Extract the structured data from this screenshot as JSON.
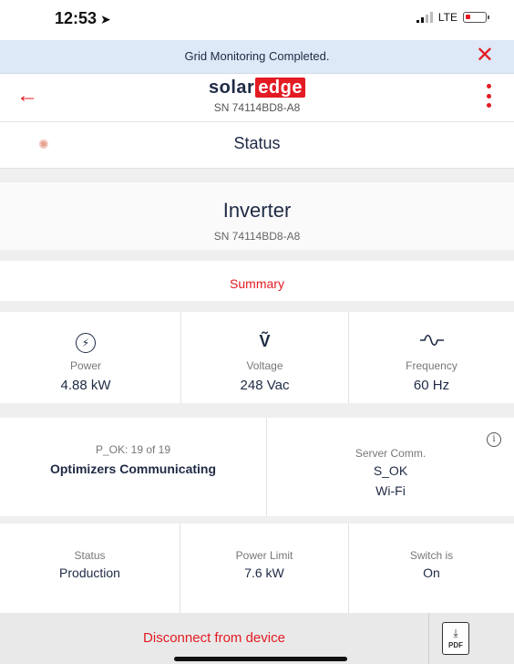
{
  "status_bar": {
    "time": "12:53",
    "network": "LTE"
  },
  "notice": {
    "text": "Grid Monitoring Completed.",
    "close_icon": "close-icon"
  },
  "header": {
    "logo_left": "solar",
    "logo_right": "edge",
    "serial": "SN 74114BD8-A8"
  },
  "status_section": {
    "title": "Status"
  },
  "inverter": {
    "title": "Inverter",
    "serial": "SN 74114BD8-A8"
  },
  "summary_link": "Summary",
  "metrics": [
    {
      "label": "Power",
      "value": "4.88 kW",
      "icon": "lightning-bolt-icon"
    },
    {
      "label": "Voltage",
      "value": "248 Vac",
      "icon": "voltage-icon"
    },
    {
      "label": "Frequency",
      "value": "60 Hz",
      "icon": "sine-wave-icon"
    }
  ],
  "comm": {
    "optimizers_label": "P_OK: 19 of 19",
    "optimizers_value": "Optimizers Communicating",
    "server_label": "Server Comm.",
    "server_value": "S_OK",
    "server_medium": "Wi-Fi"
  },
  "state": [
    {
      "label": "Status",
      "value": "Production"
    },
    {
      "label": "Power Limit",
      "value": "7.6 kW"
    },
    {
      "label": "Switch is",
      "value": "On"
    }
  ],
  "footer": {
    "disconnect": "Disconnect from device",
    "pdf_label": "PDF"
  },
  "colors": {
    "accent": "#e31b23",
    "text": "#1f2a44",
    "notice_bg": "#dde9f6"
  }
}
